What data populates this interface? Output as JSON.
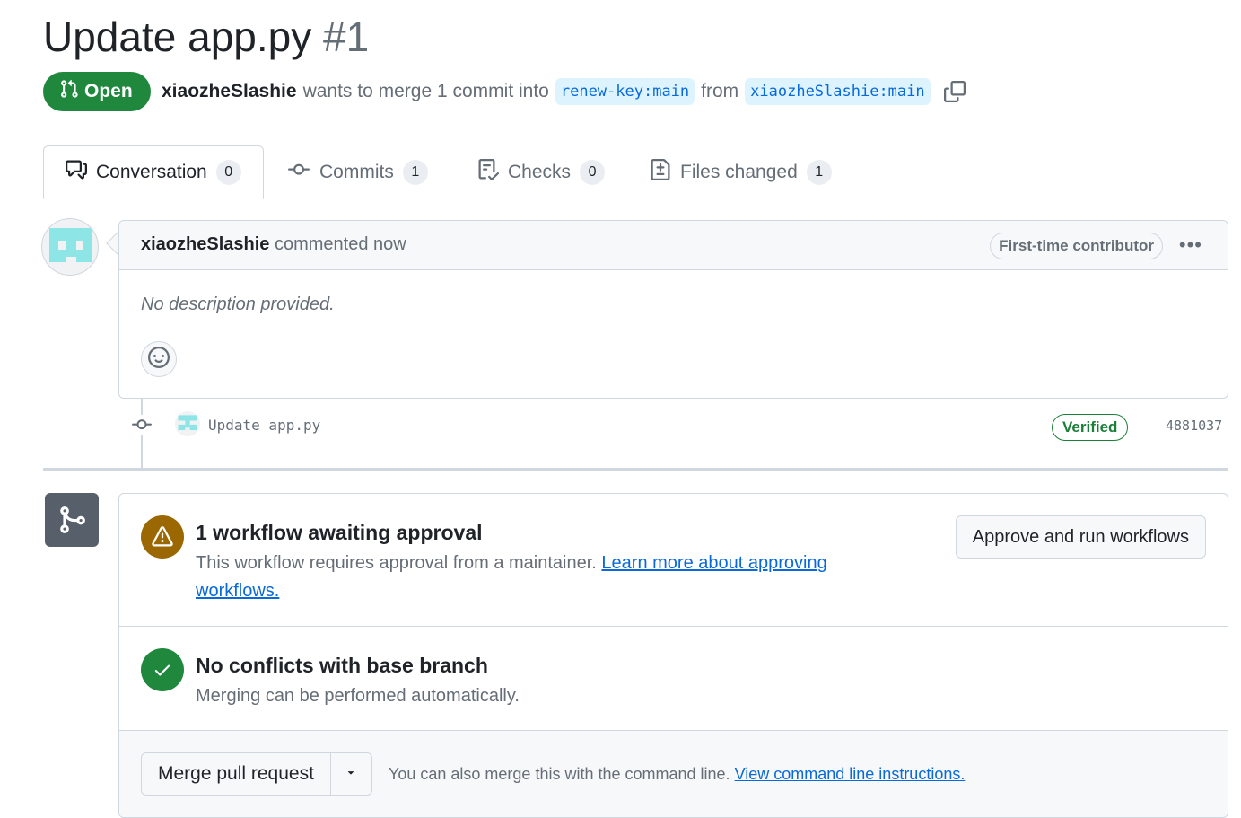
{
  "pr": {
    "title": "Update app.py",
    "number": "#1",
    "state": "Open",
    "author": "xiaozheSlashie",
    "merge_text": "wants to merge 1 commit into",
    "base_branch": "renew-key:main",
    "from_text": "from",
    "head_branch": "xiaozheSlashie:main"
  },
  "tabs": [
    {
      "label": "Conversation",
      "count": "0"
    },
    {
      "label": "Commits",
      "count": "1"
    },
    {
      "label": "Checks",
      "count": "0"
    },
    {
      "label": "Files changed",
      "count": "1"
    }
  ],
  "comment": {
    "author": "xiaozheSlashie",
    "time": "commented now",
    "badge": "First-time contributor",
    "more": "•••",
    "body": "No description provided."
  },
  "commit": {
    "message": "Update app.py",
    "verified": "Verified",
    "sha": "4881037"
  },
  "workflow": {
    "title": "1 workflow awaiting approval",
    "desc": "This workflow requires approval from a maintainer.",
    "link": "Learn more about approving workflows.",
    "button": "Approve and run workflows"
  },
  "conflicts": {
    "title": "No conflicts with base branch",
    "desc": "Merging can be performed automatically."
  },
  "merge": {
    "button": "Merge pull request",
    "text": "You can also merge this with the command line.",
    "link": "View command line instructions."
  },
  "colors": {
    "open": "#1f883d",
    "warning": "#9a6700",
    "success": "#1f883d",
    "link": "#0969da"
  }
}
